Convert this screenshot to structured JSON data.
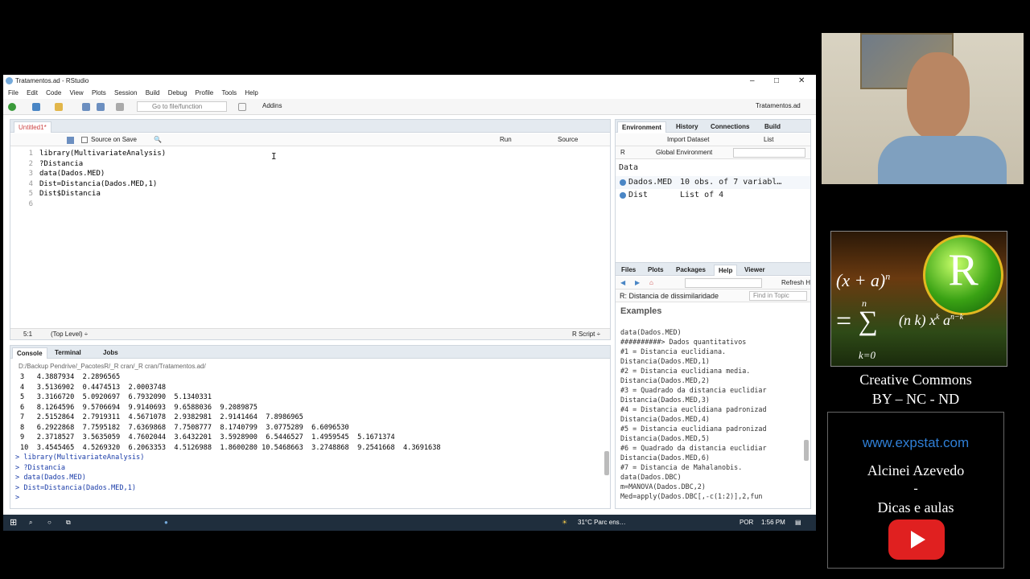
{
  "window": {
    "title": "Tratamentos.ad - RStudio",
    "controls": {
      "minimize": "–",
      "maximize": "□",
      "close": "✕"
    }
  },
  "menu": [
    "File",
    "Edit",
    "Code",
    "View",
    "Plots",
    "Session",
    "Build",
    "Debug",
    "Profile",
    "Tools",
    "Help"
  ],
  "toolbar": {
    "goto_placeholder": "Go to file/function",
    "addins": "Addins",
    "project": "Tratamentos.ad"
  },
  "editor": {
    "tab": "Untitled1*",
    "source_on_save": "Source on Save",
    "run": "Run",
    "source": "Source",
    "lines": [
      {
        "n": "1",
        "text": "library(MultivariateAnalysis)"
      },
      {
        "n": "2",
        "text": "?Distancia"
      },
      {
        "n": "3",
        "text": "data(Dados.MED)"
      },
      {
        "n": "4",
        "text": "Dist=Distancia(Dados.MED,1)"
      },
      {
        "n": "5",
        "text": "Dist$Distancia"
      },
      {
        "n": "6",
        "text": ""
      }
    ],
    "status_pos": "5:1",
    "status_scope": "(Top Level) ÷",
    "status_lang": "R Script ÷"
  },
  "console": {
    "tabs": [
      "Console",
      "Terminal",
      "Jobs"
    ],
    "path": "D:/Backup Pendrive/_PacotesR/_R cran/_R cran/Tratamentos.ad/",
    "output": [
      "3   4.3887934  2.2896565",
      "4   3.5136902  0.4474513  2.0003748",
      "5   3.3166720  5.0920697  6.7932090  5.1340331",
      "6   8.1264596  9.5706694  9.9140693  9.6588036  9.2089875",
      "7   2.5152864  2.7919311  4.5671078  2.9382981  2.9141464  7.8986965",
      "8   6.2922868  7.7595182  7.6369868  7.7508777  8.1740799  3.0775289  6.6096530",
      "9   2.3718527  3.5635059  4.7602044  3.6432201  3.5928900  6.5446527  1.4959545  5.1671374",
      "10  3.4545465  4.5269320  6.2063353  4.5126988  1.8600280 10.5468663  3.2748868  9.2541668  4.3691638"
    ],
    "commands": [
      "> library(MultivariateAnalysis)",
      "> ?Distancia",
      "> data(Dados.MED)",
      "> Dist=Distancia(Dados.MED,1)",
      "> "
    ]
  },
  "environment": {
    "tabs": [
      "Environment",
      "History",
      "Connections",
      "Build"
    ],
    "import_dataset": "Import Dataset",
    "list_view": "List",
    "lang": "R",
    "scope": "Global Environment",
    "section": "Data",
    "items": [
      {
        "name": "Dados.MED",
        "value": "10 obs. of 7 variabl…"
      },
      {
        "name": "Dist",
        "value": "List of  4"
      }
    ]
  },
  "help": {
    "tabs": [
      "Files",
      "Plots",
      "Packages",
      "Help",
      "Viewer"
    ],
    "refresh": "Refresh H",
    "topic": "R: Distancia de dissimilaridade",
    "find_placeholder": "Find in Topic",
    "heading": "Examples",
    "lines": [
      "data(Dados.MED)",
      "##########> Dados quantitativos",
      "#1 = Distancia euclidiana.",
      "Distancia(Dados.MED,1)",
      "#2 = Distancia euclidiana media.",
      "Distancia(Dados.MED,2)",
      "#3 = Quadrado da distancia euclidiar",
      "Distancia(Dados.MED,3)",
      "#4 = Distancia euclidiana padronizad",
      "Distancia(Dados.MED,4)",
      "#5 = Distancia euclidiana padronizad",
      "Distancia(Dados.MED,5)",
      "#6 = Quadrado da distancia euclidiar",
      "Distancia(Dados.MED,6)",
      "#7 = Distancia de Mahalanobis.",
      "data(Dados.DBC)",
      "m=MANOVA(Dados.DBC,2)",
      "Med=apply(Dados.DBC[,-c(1:2)],2,fun"
    ]
  },
  "taskbar": {
    "weather": "31°C  Parc ens…",
    "lang": "POR",
    "time": "1:56 PM"
  },
  "overlay": {
    "license_line1": "Creative Commons",
    "license_line2": "BY – NC - ND",
    "website": "www.expstat.com",
    "author": "Alcinei Azevedo",
    "dash": "-",
    "tagline": "Dicas e aulas",
    "logo_letter": "R",
    "formula_left": "(x + a)",
    "formula_exp": "n",
    "formula_sum": "= ∑",
    "formula_top": "n",
    "formula_bottom": "k=0",
    "formula_right": "x",
    "formula_binom": "(n k)",
    "formula_k": "k",
    "formula_a": "a",
    "formula_nk": "n−k"
  }
}
